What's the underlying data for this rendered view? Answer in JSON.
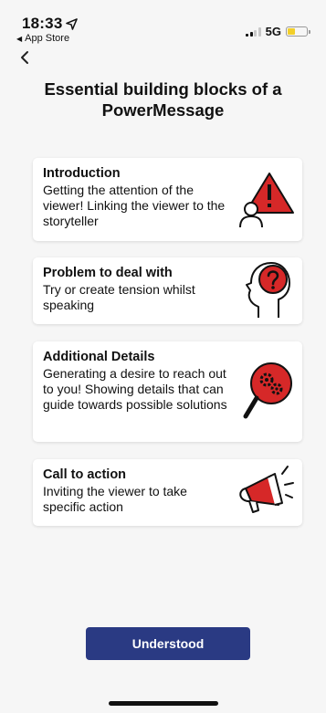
{
  "status_bar": {
    "time": "18:33",
    "back_app": "App Store",
    "network": "5G",
    "battery_level": 0.35,
    "battery_color": "#f2cf2a"
  },
  "page": {
    "title": "Essential building blocks of a PowerMessage"
  },
  "cards": [
    {
      "title": "Introduction",
      "description": "Getting the attention of the viewer! Linking the viewer to the storyteller",
      "icon": "warning-viewer-icon"
    },
    {
      "title": "Problem to deal with",
      "description": "Try or create tension whilst speaking",
      "icon": "head-question-icon"
    },
    {
      "title": "Additional Details",
      "description": "Generating a desire to reach out to you! Showing details that can guide towards possible solutions",
      "icon": "magnifier-gears-icon"
    },
    {
      "title": "Call to action",
      "description": "Inviting the viewer to take specific action",
      "icon": "megaphone-icon"
    }
  ],
  "actions": {
    "understood_label": "Understood"
  },
  "colors": {
    "accent": "#2a3a83",
    "icon_red": "#d62828",
    "background": "#f6f6f6"
  }
}
